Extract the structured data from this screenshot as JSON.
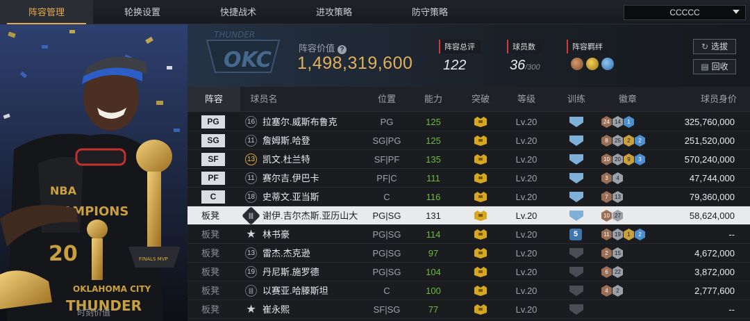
{
  "nav": {
    "tabs": [
      "阵容管理",
      "轮换设置",
      "快捷战术",
      "进攻策略",
      "防守策略"
    ],
    "active_tab": 0,
    "select_value": "CCCCC"
  },
  "portrait": {
    "bottom_label": "时刻价值"
  },
  "header": {
    "team_logo": "okc-logo",
    "value_label": "阵容价值",
    "value_help_icon": "?",
    "value": "1,498,319,600",
    "overall_label": "阵容总评",
    "overall": "122",
    "count_label": "球员数",
    "count": "36",
    "count_max": "/300",
    "bond_label": "阵容羁绊",
    "select_button": "选拔",
    "recycle_button": "回收"
  },
  "table": {
    "headers": [
      "阵容",
      "球员名",
      "位置",
      "能力",
      "突破",
      "等级",
      "训练",
      "徽章",
      "球员身价"
    ],
    "rows": [
      {
        "slot": "PG",
        "is_starter": true,
        "jersey": "16",
        "jersey_style": "plain",
        "name": "拉塞尔.威斯布鲁克",
        "pos": "PG",
        "ability": "125",
        "level": "Lv.20",
        "train": "on",
        "badges": [
          {
            "t": "br",
            "v": "24"
          },
          {
            "t": "sl",
            "v": "14"
          },
          {
            "t": "bl",
            "v": "1"
          }
        ],
        "price": "325,760,000"
      },
      {
        "slot": "SG",
        "is_starter": true,
        "jersey": "11",
        "jersey_style": "plain",
        "name": "詹姆斯.哈登",
        "pos": "SG|PG",
        "ability": "125",
        "level": "Lv.20",
        "train": "on",
        "badges": [
          {
            "t": "br",
            "v": "8"
          },
          {
            "t": "sl",
            "v": "25"
          },
          {
            "t": "gd",
            "v": "2"
          },
          {
            "t": "bl",
            "v": "2"
          }
        ],
        "price": "251,520,000"
      },
      {
        "slot": "SF",
        "is_starter": true,
        "jersey": "13",
        "jersey_style": "gold",
        "name": "凯文.杜兰特",
        "pos": "SF|PF",
        "ability": "135",
        "level": "Lv.20",
        "train": "on",
        "badges": [
          {
            "t": "br",
            "v": "10"
          },
          {
            "t": "sl",
            "v": "20"
          },
          {
            "t": "gd",
            "v": "9"
          },
          {
            "t": "bl",
            "v": "3"
          }
        ],
        "price": "570,240,000"
      },
      {
        "slot": "PF",
        "is_starter": true,
        "jersey": "11",
        "jersey_style": "plain",
        "name": "赛尔吉.伊巴卡",
        "pos": "PF|C",
        "ability": "111",
        "level": "Lv.20",
        "train": "on",
        "badges": [
          {
            "t": "br",
            "v": "3"
          },
          {
            "t": "sl",
            "v": "4"
          }
        ],
        "price": "47,744,000"
      },
      {
        "slot": "C",
        "is_starter": true,
        "jersey": "18",
        "jersey_style": "plain",
        "name": "史蒂文.亚当斯",
        "pos": "C",
        "ability": "116",
        "level": "Lv.20",
        "train": "on",
        "badges": [
          {
            "t": "br",
            "v": "7"
          },
          {
            "t": "sl",
            "v": "13"
          }
        ],
        "price": "79,360,000"
      },
      {
        "slot": "板凳",
        "is_starter": false,
        "selected": true,
        "jersey": "|||",
        "jersey_style": "diamond",
        "name": "谢伊.吉尔杰斯.亚历山大",
        "pos": "PG|SG",
        "ability": "131",
        "level": "Lv.20",
        "train": "on",
        "badges": [
          {
            "t": "br",
            "v": "10"
          },
          {
            "t": "sl",
            "v": "27"
          }
        ],
        "price": "58,624,000"
      },
      {
        "slot": "板凳",
        "is_starter": false,
        "jersey": "★",
        "jersey_style": "star",
        "name": "林书豪",
        "pos": "PG|SG",
        "ability": "114",
        "level": "Lv.20",
        "train": "5",
        "badges": [
          {
            "t": "br",
            "v": "11"
          },
          {
            "t": "sl",
            "v": "19"
          },
          {
            "t": "gd",
            "v": "1"
          },
          {
            "t": "bl",
            "v": "2"
          }
        ],
        "price": "--"
      },
      {
        "slot": "板凳",
        "is_starter": false,
        "jersey": "13",
        "jersey_style": "plain",
        "name": "雷杰.杰克逊",
        "pos": "PG|SG",
        "ability": "97",
        "level": "Lv.20",
        "train": "off",
        "badges": [
          {
            "t": "br",
            "v": "2"
          },
          {
            "t": "sl",
            "v": "15"
          }
        ],
        "price": "4,672,000"
      },
      {
        "slot": "板凳",
        "is_starter": false,
        "jersey": "19",
        "jersey_style": "plain",
        "name": "丹尼斯.施罗德",
        "pos": "PG|SG",
        "ability": "104",
        "level": "Lv.20",
        "train": "off",
        "badges": [
          {
            "t": "br",
            "v": "6"
          },
          {
            "t": "sl",
            "v": "22"
          }
        ],
        "price": "3,872,000"
      },
      {
        "slot": "板凳",
        "is_starter": false,
        "jersey": "|||",
        "jersey_style": "bars",
        "name": "以赛亚.哈滕斯坦",
        "pos": "C",
        "ability": "100",
        "level": "Lv.20",
        "train": "off",
        "badges": [
          {
            "t": "br",
            "v": "4"
          },
          {
            "t": "sl",
            "v": "2"
          }
        ],
        "price": "2,777,600"
      },
      {
        "slot": "板凳",
        "is_starter": false,
        "jersey": "★",
        "jersey_style": "star",
        "name": "崔永熙",
        "pos": "SF|SG",
        "ability": "77",
        "level": "Lv.20",
        "train": "off",
        "badges": [],
        "price": "--"
      }
    ]
  },
  "colors": {
    "accent": "#e3a94e",
    "ability_green": "#6bbd3f",
    "value_gold": "#e2b05a"
  }
}
